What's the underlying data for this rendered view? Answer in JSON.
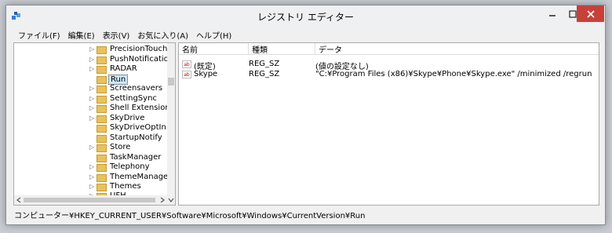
{
  "window": {
    "title": "レジストリ エディター"
  },
  "menu": [
    "ファイル(F)",
    "編集(E)",
    "表示(V)",
    "お気に入り(A)",
    "ヘルプ(H)"
  ],
  "tree": {
    "items": [
      {
        "label": "PrecisionTouchPac",
        "selected": false
      },
      {
        "label": "PushNotifications",
        "selected": false
      },
      {
        "label": "RADAR",
        "selected": false
      },
      {
        "label": "Run",
        "selected": true
      },
      {
        "label": "Screensavers",
        "selected": false
      },
      {
        "label": "SettingSync",
        "selected": false
      },
      {
        "label": "Shell Extensions",
        "selected": false
      },
      {
        "label": "SkyDrive",
        "selected": false
      },
      {
        "label": "SkyDriveOptIn",
        "selected": false
      },
      {
        "label": "StartupNotify",
        "selected": false
      },
      {
        "label": "Store",
        "selected": false
      },
      {
        "label": "TaskManager",
        "selected": false
      },
      {
        "label": "Telephony",
        "selected": false
      },
      {
        "label": "ThemeManager",
        "selected": false
      },
      {
        "label": "Themes",
        "selected": false
      },
      {
        "label": "UFH",
        "selected": false
      }
    ]
  },
  "list": {
    "columns": [
      "名前",
      "種類",
      "データ"
    ],
    "rows": [
      {
        "name": "(既定)",
        "type": "REG_SZ",
        "data": "(値の設定なし)"
      },
      {
        "name": "Skype",
        "type": "REG_SZ",
        "data": "\"C:¥Program Files (x86)¥Skype¥Phone¥Skype.exe\" /minimized /regrun"
      }
    ]
  },
  "status": {
    "path": "コンピューター¥HKEY_CURRENT_USER¥Software¥Microsoft¥Windows¥CurrentVersion¥Run"
  },
  "icons": {
    "value": "ab-string-icon",
    "key": "folder-icon",
    "expand": "chevron-right-icon"
  },
  "colors": {
    "close": "#c7413a",
    "folder": "#e8c25c",
    "selected": "#cce8ff"
  }
}
